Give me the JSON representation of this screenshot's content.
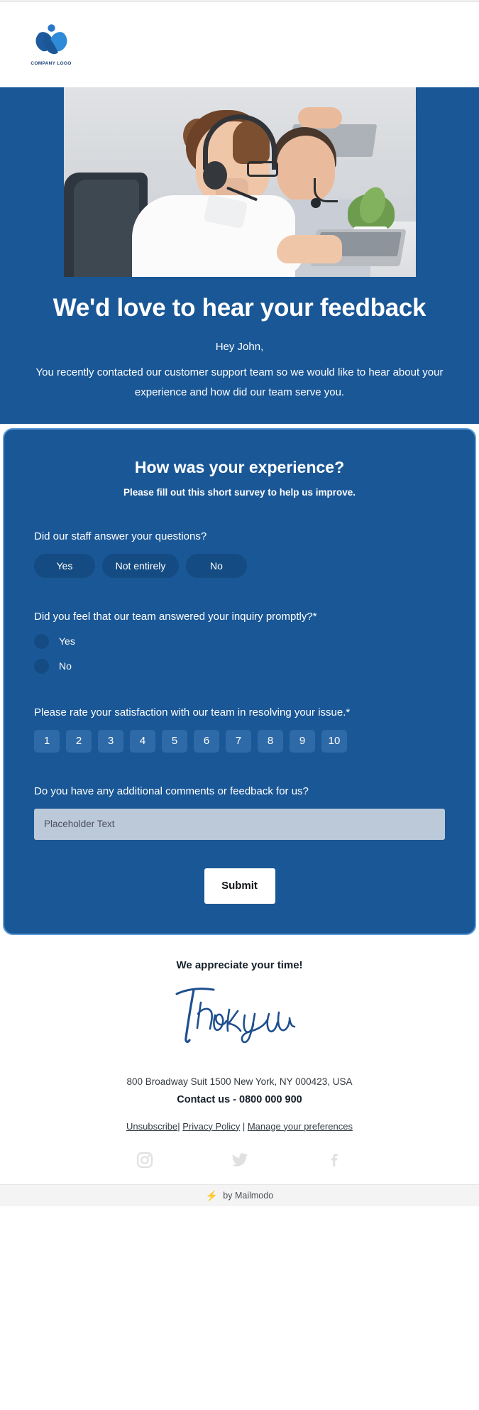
{
  "header": {
    "logo_icon": "butterfly-x-logo-icon",
    "logo_caption": "COMPANY LOGO"
  },
  "hero": {
    "image_alt": "customer-support-agents-photo",
    "title": "We'd love to hear your feedback",
    "greeting": "Hey John,",
    "body": "You recently contacted our customer support team so we would like to hear about your experience and how did our team serve you."
  },
  "survey": {
    "title": "How was your experience?",
    "subtitle": "Please fill out this short survey to help us improve.",
    "q1": {
      "label": "Did our staff answer your questions?",
      "options": [
        "Yes",
        "Not entirely",
        "No"
      ]
    },
    "q2": {
      "label": "Did you feel that our team answered your inquiry promptly?*",
      "options": [
        "Yes",
        "No"
      ]
    },
    "q3": {
      "label": "Please rate your satisfaction with our team in resolving your issue.*",
      "options": [
        "1",
        "2",
        "3",
        "4",
        "5",
        "6",
        "7",
        "8",
        "9",
        "10"
      ]
    },
    "q4": {
      "label": "Do you have any additional comments or feedback for us?",
      "placeholder": "Placeholder Text",
      "value": ""
    },
    "submit_label": "Submit"
  },
  "footer": {
    "appreciate": "We appreciate your time!",
    "signature": "Thankyou",
    "address": "800 Broadway Suit 1500 New York, NY 000423, USA",
    "contact": "Contact us - 0800 000 900",
    "links": [
      "Unsubscribe",
      "Privacy Policy",
      "Manage your preferences"
    ],
    "link_separator_1": "| ",
    "link_separator_2": " | ",
    "social": [
      "instagram-icon",
      "twitter-icon",
      "facebook-icon"
    ],
    "mailmodo": "by Mailmodo",
    "mailmodo_icon": "lightning-bolt-icon"
  },
  "colors": {
    "brand_blue": "#1a5796",
    "card_border": "#5b9bd5",
    "pill_blue": "#144b82",
    "rating_blue": "#2f6aa8",
    "input_bg": "#bcc9d9",
    "signature_blue": "#1f4f8f",
    "mailmodo_orange": "#f2741c",
    "social_gray": "#e0e0e0"
  }
}
